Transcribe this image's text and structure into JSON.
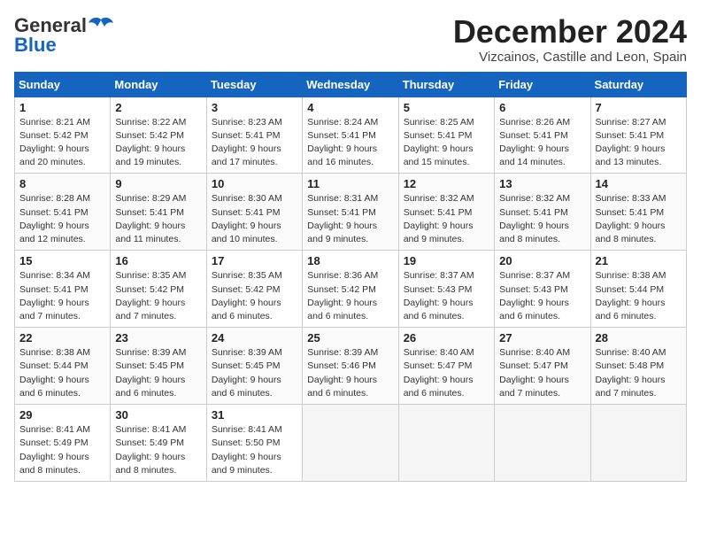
{
  "header": {
    "logo_general": "General",
    "logo_blue": "Blue",
    "month_title": "December 2024",
    "location": "Vizcainos, Castille and Leon, Spain"
  },
  "days_of_week": [
    "Sunday",
    "Monday",
    "Tuesday",
    "Wednesday",
    "Thursday",
    "Friday",
    "Saturday"
  ],
  "weeks": [
    [
      {
        "day": "1",
        "sunrise": "Sunrise: 8:21 AM",
        "sunset": "Sunset: 5:42 PM",
        "daylight": "Daylight: 9 hours and 20 minutes."
      },
      {
        "day": "2",
        "sunrise": "Sunrise: 8:22 AM",
        "sunset": "Sunset: 5:42 PM",
        "daylight": "Daylight: 9 hours and 19 minutes."
      },
      {
        "day": "3",
        "sunrise": "Sunrise: 8:23 AM",
        "sunset": "Sunset: 5:41 PM",
        "daylight": "Daylight: 9 hours and 17 minutes."
      },
      {
        "day": "4",
        "sunrise": "Sunrise: 8:24 AM",
        "sunset": "Sunset: 5:41 PM",
        "daylight": "Daylight: 9 hours and 16 minutes."
      },
      {
        "day": "5",
        "sunrise": "Sunrise: 8:25 AM",
        "sunset": "Sunset: 5:41 PM",
        "daylight": "Daylight: 9 hours and 15 minutes."
      },
      {
        "day": "6",
        "sunrise": "Sunrise: 8:26 AM",
        "sunset": "Sunset: 5:41 PM",
        "daylight": "Daylight: 9 hours and 14 minutes."
      },
      {
        "day": "7",
        "sunrise": "Sunrise: 8:27 AM",
        "sunset": "Sunset: 5:41 PM",
        "daylight": "Daylight: 9 hours and 13 minutes."
      }
    ],
    [
      {
        "day": "8",
        "sunrise": "Sunrise: 8:28 AM",
        "sunset": "Sunset: 5:41 PM",
        "daylight": "Daylight: 9 hours and 12 minutes."
      },
      {
        "day": "9",
        "sunrise": "Sunrise: 8:29 AM",
        "sunset": "Sunset: 5:41 PM",
        "daylight": "Daylight: 9 hours and 11 minutes."
      },
      {
        "day": "10",
        "sunrise": "Sunrise: 8:30 AM",
        "sunset": "Sunset: 5:41 PM",
        "daylight": "Daylight: 9 hours and 10 minutes."
      },
      {
        "day": "11",
        "sunrise": "Sunrise: 8:31 AM",
        "sunset": "Sunset: 5:41 PM",
        "daylight": "Daylight: 9 hours and 9 minutes."
      },
      {
        "day": "12",
        "sunrise": "Sunrise: 8:32 AM",
        "sunset": "Sunset: 5:41 PM",
        "daylight": "Daylight: 9 hours and 9 minutes."
      },
      {
        "day": "13",
        "sunrise": "Sunrise: 8:32 AM",
        "sunset": "Sunset: 5:41 PM",
        "daylight": "Daylight: 9 hours and 8 minutes."
      },
      {
        "day": "14",
        "sunrise": "Sunrise: 8:33 AM",
        "sunset": "Sunset: 5:41 PM",
        "daylight": "Daylight: 9 hours and 8 minutes."
      }
    ],
    [
      {
        "day": "15",
        "sunrise": "Sunrise: 8:34 AM",
        "sunset": "Sunset: 5:41 PM",
        "daylight": "Daylight: 9 hours and 7 minutes."
      },
      {
        "day": "16",
        "sunrise": "Sunrise: 8:35 AM",
        "sunset": "Sunset: 5:42 PM",
        "daylight": "Daylight: 9 hours and 7 minutes."
      },
      {
        "day": "17",
        "sunrise": "Sunrise: 8:35 AM",
        "sunset": "Sunset: 5:42 PM",
        "daylight": "Daylight: 9 hours and 6 minutes."
      },
      {
        "day": "18",
        "sunrise": "Sunrise: 8:36 AM",
        "sunset": "Sunset: 5:42 PM",
        "daylight": "Daylight: 9 hours and 6 minutes."
      },
      {
        "day": "19",
        "sunrise": "Sunrise: 8:37 AM",
        "sunset": "Sunset: 5:43 PM",
        "daylight": "Daylight: 9 hours and 6 minutes."
      },
      {
        "day": "20",
        "sunrise": "Sunrise: 8:37 AM",
        "sunset": "Sunset: 5:43 PM",
        "daylight": "Daylight: 9 hours and 6 minutes."
      },
      {
        "day": "21",
        "sunrise": "Sunrise: 8:38 AM",
        "sunset": "Sunset: 5:44 PM",
        "daylight": "Daylight: 9 hours and 6 minutes."
      }
    ],
    [
      {
        "day": "22",
        "sunrise": "Sunrise: 8:38 AM",
        "sunset": "Sunset: 5:44 PM",
        "daylight": "Daylight: 9 hours and 6 minutes."
      },
      {
        "day": "23",
        "sunrise": "Sunrise: 8:39 AM",
        "sunset": "Sunset: 5:45 PM",
        "daylight": "Daylight: 9 hours and 6 minutes."
      },
      {
        "day": "24",
        "sunrise": "Sunrise: 8:39 AM",
        "sunset": "Sunset: 5:45 PM",
        "daylight": "Daylight: 9 hours and 6 minutes."
      },
      {
        "day": "25",
        "sunrise": "Sunrise: 8:39 AM",
        "sunset": "Sunset: 5:46 PM",
        "daylight": "Daylight: 9 hours and 6 minutes."
      },
      {
        "day": "26",
        "sunrise": "Sunrise: 8:40 AM",
        "sunset": "Sunset: 5:47 PM",
        "daylight": "Daylight: 9 hours and 6 minutes."
      },
      {
        "day": "27",
        "sunrise": "Sunrise: 8:40 AM",
        "sunset": "Sunset: 5:47 PM",
        "daylight": "Daylight: 9 hours and 7 minutes."
      },
      {
        "day": "28",
        "sunrise": "Sunrise: 8:40 AM",
        "sunset": "Sunset: 5:48 PM",
        "daylight": "Daylight: 9 hours and 7 minutes."
      }
    ],
    [
      {
        "day": "29",
        "sunrise": "Sunrise: 8:41 AM",
        "sunset": "Sunset: 5:49 PM",
        "daylight": "Daylight: 9 hours and 8 minutes."
      },
      {
        "day": "30",
        "sunrise": "Sunrise: 8:41 AM",
        "sunset": "Sunset: 5:49 PM",
        "daylight": "Daylight: 9 hours and 8 minutes."
      },
      {
        "day": "31",
        "sunrise": "Sunrise: 8:41 AM",
        "sunset": "Sunset: 5:50 PM",
        "daylight": "Daylight: 9 hours and 9 minutes."
      },
      null,
      null,
      null,
      null
    ]
  ]
}
